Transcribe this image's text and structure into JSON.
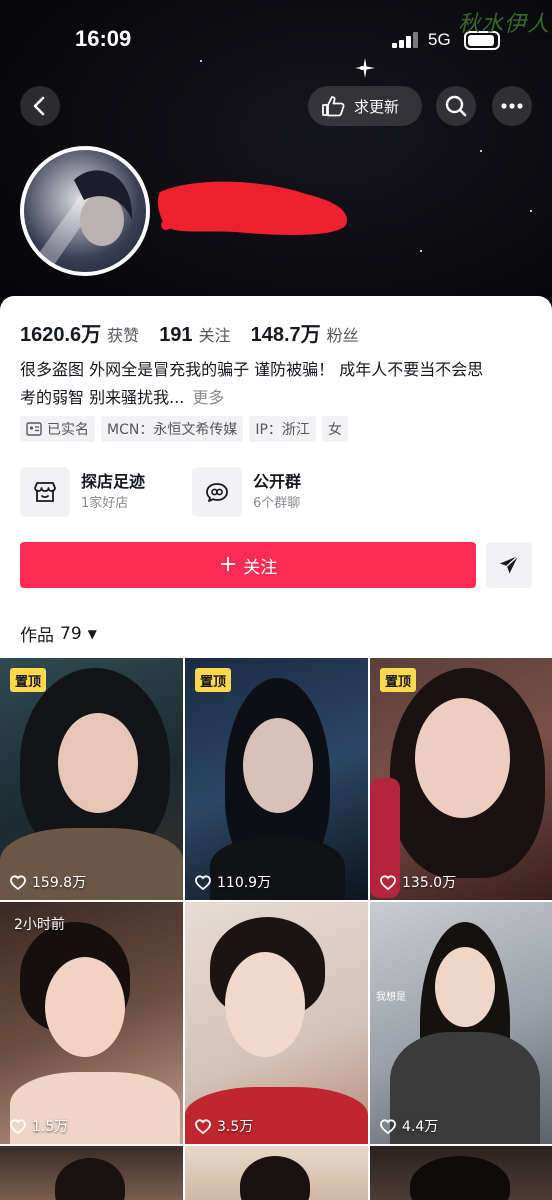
{
  "status_bar": {
    "time": "16:09",
    "network": "5G"
  },
  "watermark": "秋水伊人",
  "nav": {
    "update_label": "求更新"
  },
  "stats": [
    {
      "value": "1620.6万",
      "label": "获赞"
    },
    {
      "value": "191",
      "label": "关注"
    },
    {
      "value": "148.7万",
      "label": "粉丝"
    }
  ],
  "bio": {
    "line1": "很多盗图 外网全是冒充我的骗子 谨防被骗！ 成年人不要当不会思",
    "line2": "考的弱智 别来骚扰我...",
    "more": "更多"
  },
  "tags": [
    {
      "label": "已实名",
      "icon": "id-card-icon"
    },
    {
      "label": "MCN：永恒文希传媒"
    },
    {
      "label": "IP：浙江"
    },
    {
      "label": "女"
    }
  ],
  "features": [
    {
      "title": "探店足迹",
      "sub": "1家好店",
      "icon": "store-icon"
    },
    {
      "title": "公开群",
      "sub": "6个群聊",
      "icon": "chat-group-icon"
    }
  ],
  "follow_button": {
    "label": "关注"
  },
  "works": {
    "label": "作品",
    "count": "79"
  },
  "videos": [
    {
      "badge": "置顶",
      "likes": "159.8万"
    },
    {
      "badge": "置顶",
      "likes": "110.9万"
    },
    {
      "badge": "置顶",
      "likes": "135.0万"
    },
    {
      "badge": "2小时前",
      "likes": "1.5万"
    },
    {
      "badge": "",
      "likes": "3.5万"
    },
    {
      "badge": "",
      "likes": "4.4万",
      "overlay": "我想是"
    }
  ],
  "colors": {
    "accent": "#fe2c55",
    "pin_badge": "#ffd84f",
    "header_bg": "#0a0a0f"
  }
}
